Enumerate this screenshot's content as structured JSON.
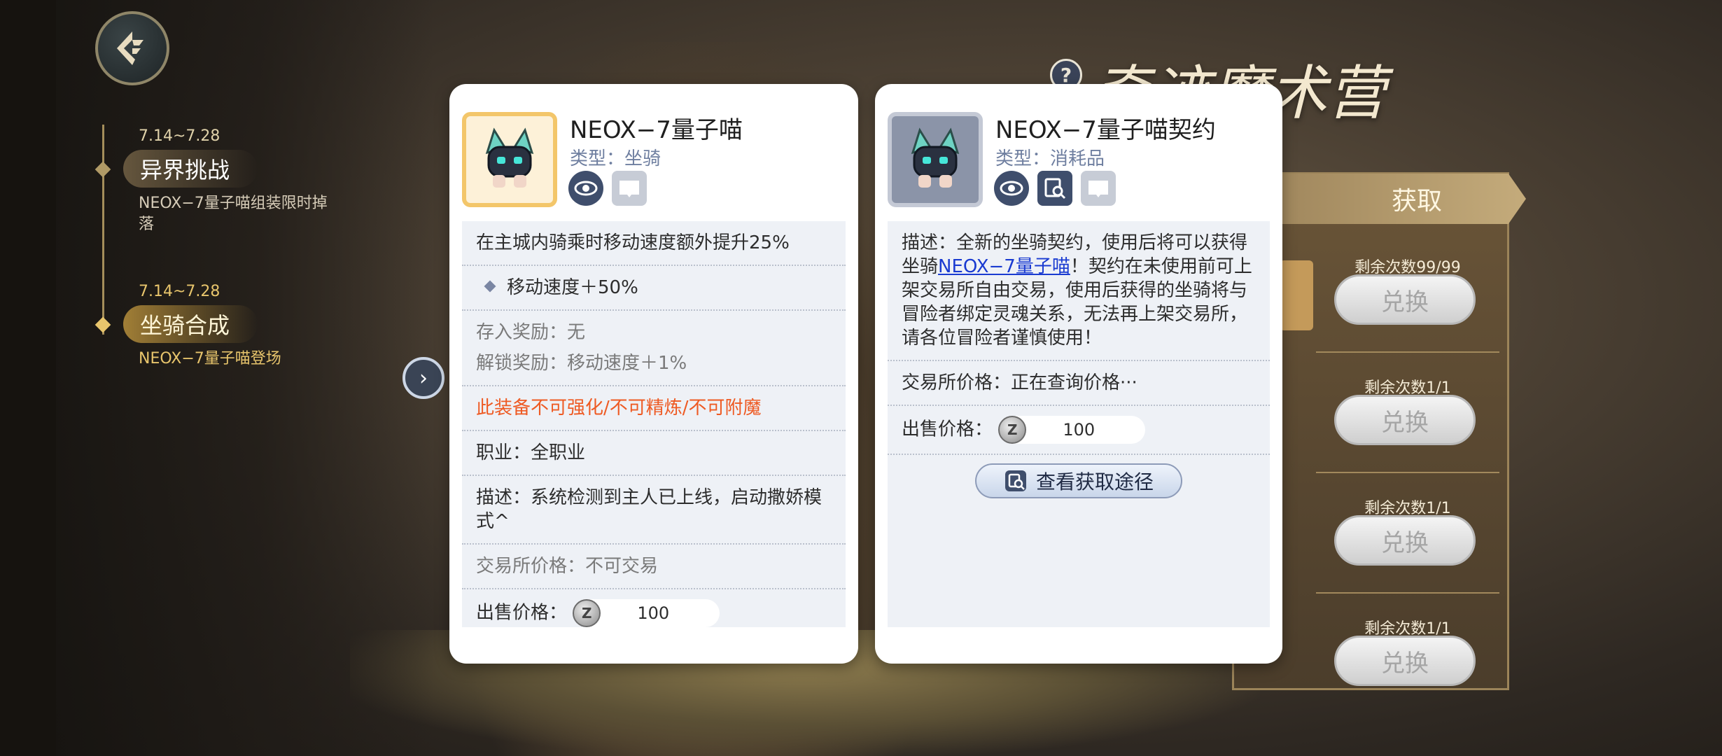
{
  "event": {
    "title": "奇迹魔术营",
    "help": "?"
  },
  "events": [
    {
      "date": "7.14~7.28",
      "title": "异界挑战",
      "desc": "NEOX−7量子喵组装限时掉落"
    },
    {
      "date": "7.14~7.28",
      "title": "坐骑合成",
      "desc": "NEOX−7量子喵登场"
    }
  ],
  "shop": {
    "header": "获取",
    "exchange_label": "兑换",
    "rows": [
      {
        "remaining": "剩余次数99/99"
      },
      {
        "remaining": "剩余次数1/1"
      },
      {
        "remaining": "剩余次数1/1"
      },
      {
        "remaining": "剩余次数1/1"
      }
    ]
  },
  "card1": {
    "name": "NEOX−7量子喵",
    "type": "类型：坐骑",
    "effect": "在主城内骑乘时移动速度额外提升25%",
    "stat": "移动速度＋50%",
    "deposit_reward": "存入奖励：无",
    "unlock_reward": "解锁奖励：移动速度＋1%",
    "restriction": "此装备不可强化/不可精炼/不可附魔",
    "job": "职业：全职业",
    "desc": "描述：系统检测到主人已上线，启动撒娇模式^",
    "trade_price": "交易所价格：不可交易",
    "sell_label": "出售价格：",
    "sell_value": "100"
  },
  "card2": {
    "name": "NEOX−7量子喵契约",
    "type": "类型：消耗品",
    "desc_before": "描述：全新的坐骑契约，使用后将可以获得坐骑",
    "desc_link": "NEOX−7量子喵",
    "desc_after": "！契约在未使用前可上架交易所自由交易，使用后获得的坐骑将与冒险者绑定灵魂关系，无法再上架交易所，请各位冒险者谨慎使用！",
    "trade_price": "交易所价格：正在查询价格···",
    "sell_label": "出售价格：",
    "sell_value": "100",
    "route_button": "查看获取途径"
  },
  "coin_symbol": "Z",
  "colors": {
    "warn": "#ee5a23",
    "link": "#1a3bd1",
    "accent_gold": "#e8c56c"
  }
}
